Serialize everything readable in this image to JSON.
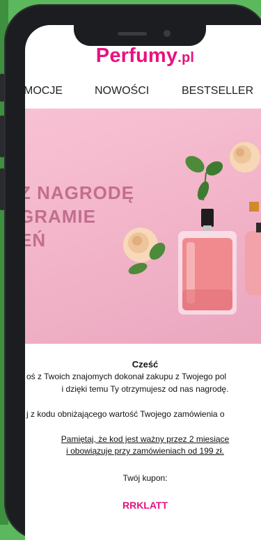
{
  "brand": {
    "name": "Perfumy",
    "suffix": ".pl",
    "color": "#e8117f"
  },
  "nav": {
    "items": [
      "MOCJE",
      "NOWOŚCI",
      "BESTSELLER"
    ]
  },
  "hero": {
    "lines": [
      "Z NAGRODĘ",
      "GRAMIE",
      "EŃ"
    ]
  },
  "email": {
    "greeting": "Cześć",
    "line1": "oś z Twoich znajomych dokonał zakupu z Twojego pol",
    "line2": "i dzięki temu Ty otrzymujesz od nas nagrodę.",
    "line3": "j z kodu obniżającego wartość Twojego zamówienia o",
    "note1": "Pamiętaj, że kod jest ważny przez 2 miesiące",
    "note2": "i obowiązuje przy zamówieniach od 199 zł.",
    "coupon_label": "Twój kupon:",
    "coupon_code": "RRKLATT"
  }
}
